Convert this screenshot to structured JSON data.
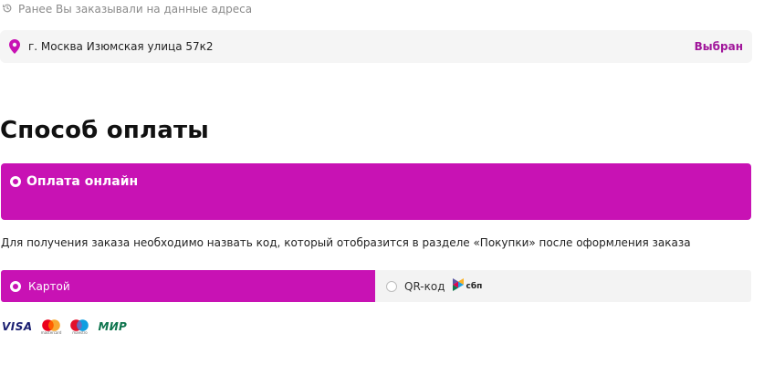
{
  "previous_addresses": {
    "heading": "Ранее Вы заказывали на данные адреса",
    "icon": "history-icon"
  },
  "address": {
    "icon": "location-pin-icon",
    "text": "г. Москва Изюмская улица 57к2",
    "status": "Выбран"
  },
  "payment": {
    "title": "Способ оплаты",
    "online_option": "Оплата онлайн",
    "hint": "Для получения заказа необходимо назвать код, который отобразится в разделе «Покупки» после оформления заказа",
    "methods": [
      {
        "label": "Картой",
        "selected": true
      },
      {
        "label": "QR-код",
        "selected": false,
        "badge": "сбп"
      }
    ],
    "card_logos": [
      {
        "name": "visa",
        "text": "VISA"
      },
      {
        "name": "mastercard",
        "caption": "mastercard"
      },
      {
        "name": "maestro",
        "caption": "maestro"
      },
      {
        "name": "mir",
        "text": "МИР"
      }
    ]
  },
  "colors": {
    "accent": "#c812b4",
    "accent_text": "#a1169b",
    "muted": "#8a8a8a",
    "card_bg": "#f5f5f5"
  }
}
